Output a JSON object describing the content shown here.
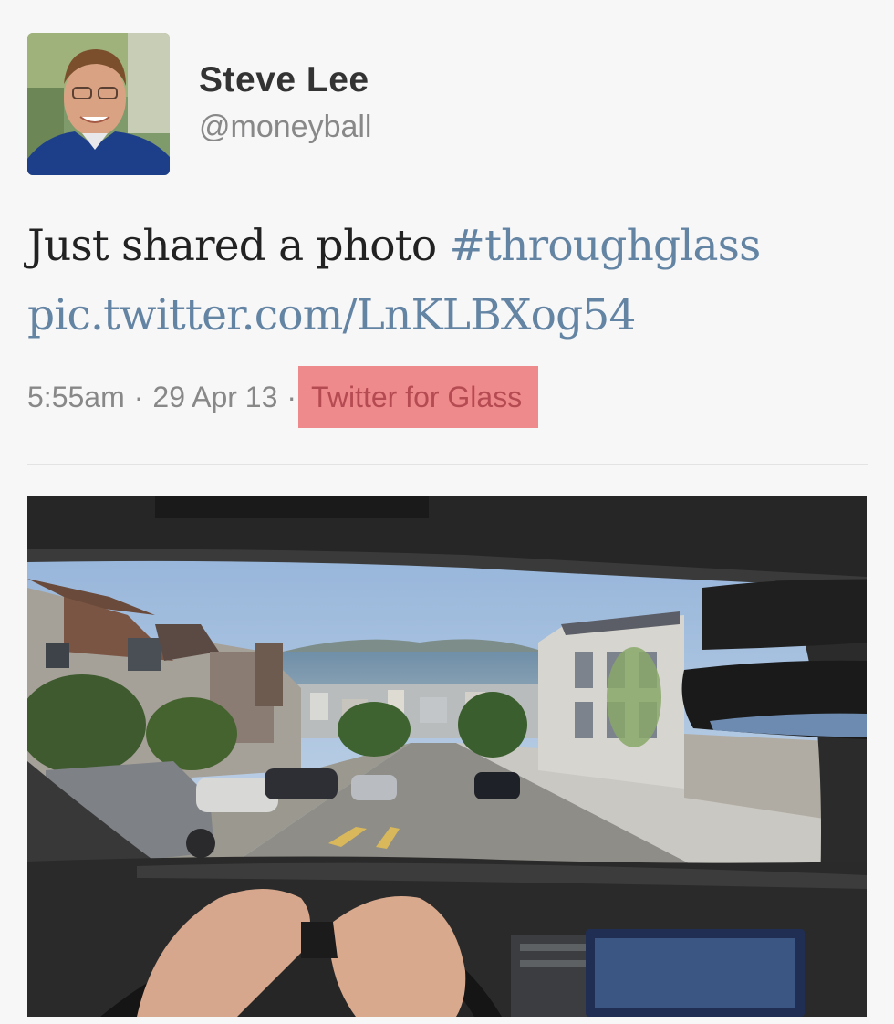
{
  "user": {
    "name": "Steve Lee",
    "handle": "@moneyball"
  },
  "tweet": {
    "text": "Just shared a photo",
    "hashtag": "#throughglass",
    "link": "pic.twitter.com/LnKLBXog54"
  },
  "meta": {
    "time": "5:55am",
    "separator": "·",
    "date": "29 Apr 13",
    "source": "Twitter for Glass"
  },
  "colors": {
    "link": "#6484a4",
    "source_highlight": "#ee8a8c",
    "source_text": "#b54b52"
  }
}
